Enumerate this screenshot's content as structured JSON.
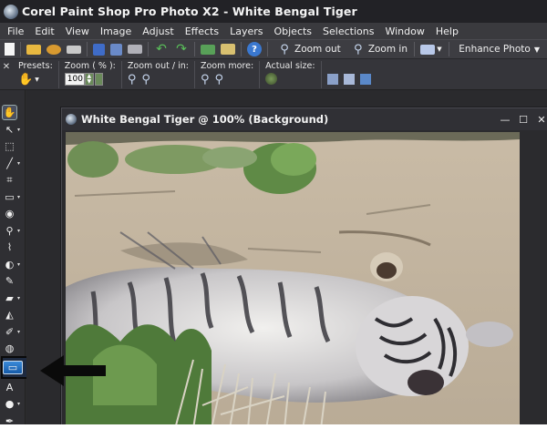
{
  "window": {
    "title": "Corel Paint Shop Pro Photo X2 - White Bengal Tiger",
    "accent": "#222226"
  },
  "menu": [
    {
      "label": "File"
    },
    {
      "label": "Edit"
    },
    {
      "label": "View"
    },
    {
      "label": "Image"
    },
    {
      "label": "Adjust"
    },
    {
      "label": "Effects"
    },
    {
      "label": "Layers"
    },
    {
      "label": "Objects"
    },
    {
      "label": "Selections"
    },
    {
      "label": "Window"
    },
    {
      "label": "Help"
    }
  ],
  "toolbar": {
    "icons": [
      "new-icon",
      "open-icon",
      "browse-icon",
      "scan-icon",
      "save-icon",
      "save-as-icon",
      "print-icon",
      "undo-icon",
      "redo-icon",
      "copy-merged-icon",
      "paste-icon",
      "help-icon"
    ],
    "zoom_out_label": "Zoom out",
    "zoom_in_label": "Zoom in",
    "enhance_label": "Enhance Photo"
  },
  "tool_options": {
    "presets_label": "Presets:",
    "zoom_pct_label": "Zoom ( % ):",
    "zoom_value": "100",
    "zoom_out_in_label": "Zoom out / in:",
    "zoom_more_label": "Zoom more:",
    "actual_size_label": "Actual size:"
  },
  "tools": [
    {
      "name": "pan-tool",
      "glyph": "✋",
      "active": true
    },
    {
      "name": "pick-tool",
      "glyph": "↖"
    },
    {
      "name": "selection-tool",
      "glyph": "⬚"
    },
    {
      "name": "dropper-tool",
      "glyph": "╱"
    },
    {
      "name": "crop-tool",
      "glyph": "⌗"
    },
    {
      "name": "straighten-tool",
      "glyph": "▭"
    },
    {
      "name": "red-eye-tool",
      "glyph": "◉"
    },
    {
      "name": "clone-tool",
      "glyph": "⚲"
    },
    {
      "name": "scratch-remover-tool",
      "glyph": "⌇"
    },
    {
      "name": "dodge-tool",
      "glyph": "◐"
    },
    {
      "name": "paint-brush-tool",
      "glyph": "✎"
    },
    {
      "name": "eraser-tool",
      "glyph": "▰"
    },
    {
      "name": "flood-fill-tool",
      "glyph": "◭"
    },
    {
      "name": "background-eraser-tool",
      "glyph": "✐"
    },
    {
      "name": "picture-tube-tool",
      "glyph": "◍"
    },
    {
      "name": "rectangle-tool",
      "glyph": "▭",
      "highlight": true
    },
    {
      "name": "text-tool",
      "glyph": "A"
    },
    {
      "name": "preset-shape-tool",
      "glyph": "●"
    },
    {
      "name": "pen-tool",
      "glyph": "✒"
    }
  ],
  "document": {
    "title": "White Bengal Tiger @ 100% (Background)"
  }
}
